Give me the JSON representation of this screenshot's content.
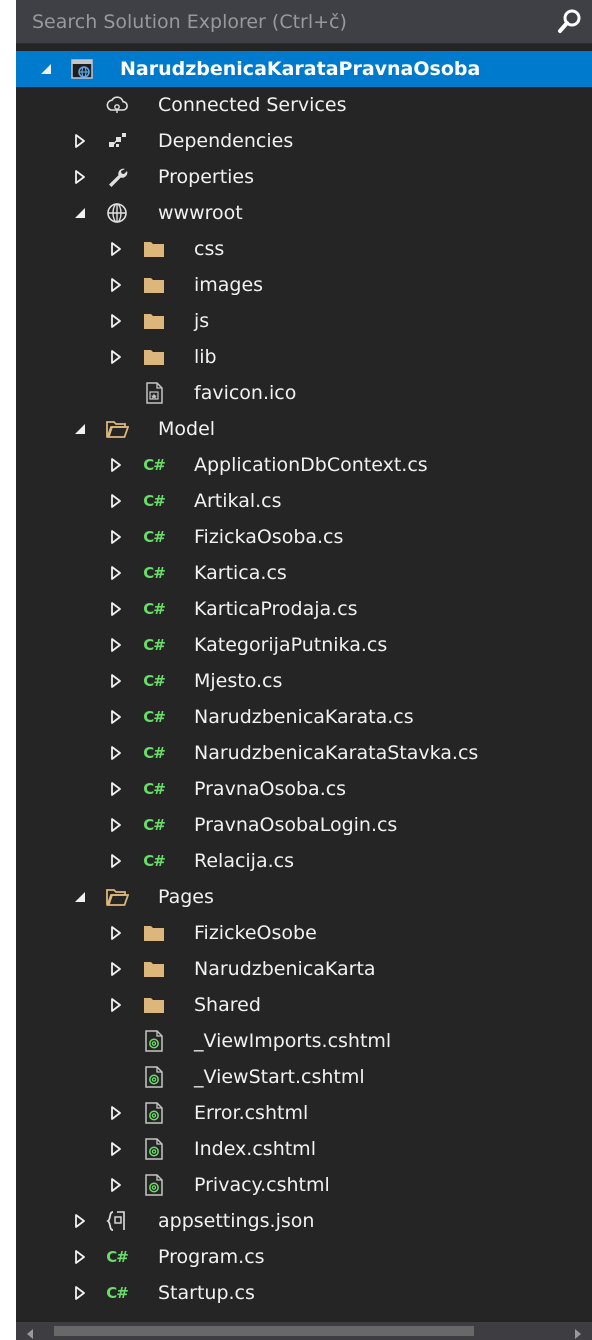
{
  "search": {
    "placeholder": "Search Solution Explorer (Ctrl+č)"
  },
  "colors": {
    "panel_background": "#252526",
    "search_background": "#3f3f46",
    "selected_row": "#007acc",
    "text": "#f1f1f1",
    "folder": "#dcb67a",
    "csharp": "#68dd68"
  },
  "tree": [
    {
      "label": "NarudzbenicaKarataPravnaOsoba",
      "level": 0,
      "toggle": "expanded",
      "icon": "web-project-icon",
      "selected": true
    },
    {
      "label": "Connected Services",
      "level": 1,
      "toggle": "none",
      "icon": "connected-services-icon"
    },
    {
      "label": "Dependencies",
      "level": 1,
      "toggle": "collapsed",
      "icon": "dependencies-icon"
    },
    {
      "label": "Properties",
      "level": 1,
      "toggle": "collapsed",
      "icon": "wrench-icon"
    },
    {
      "label": "wwwroot",
      "level": 1,
      "toggle": "expanded",
      "icon": "globe-icon"
    },
    {
      "label": "css",
      "level": 2,
      "toggle": "collapsed",
      "icon": "folder-icon"
    },
    {
      "label": "images",
      "level": 2,
      "toggle": "collapsed",
      "icon": "folder-icon"
    },
    {
      "label": "js",
      "level": 2,
      "toggle": "collapsed",
      "icon": "folder-icon"
    },
    {
      "label": "lib",
      "level": 2,
      "toggle": "collapsed",
      "icon": "folder-icon"
    },
    {
      "label": "favicon.ico",
      "level": 2,
      "toggle": "none",
      "icon": "ico-file-icon"
    },
    {
      "label": "Model",
      "level": 1,
      "toggle": "expanded",
      "icon": "folder-open-icon"
    },
    {
      "label": "ApplicationDbContext.cs",
      "level": 2,
      "toggle": "collapsed",
      "icon": "csharp-file-icon"
    },
    {
      "label": "Artikal.cs",
      "level": 2,
      "toggle": "collapsed",
      "icon": "csharp-file-icon"
    },
    {
      "label": "FizickaOsoba.cs",
      "level": 2,
      "toggle": "collapsed",
      "icon": "csharp-file-icon"
    },
    {
      "label": "Kartica.cs",
      "level": 2,
      "toggle": "collapsed",
      "icon": "csharp-file-icon"
    },
    {
      "label": "KarticaProdaja.cs",
      "level": 2,
      "toggle": "collapsed",
      "icon": "csharp-file-icon"
    },
    {
      "label": "KategorijaPutnika.cs",
      "level": 2,
      "toggle": "collapsed",
      "icon": "csharp-file-icon"
    },
    {
      "label": "Mjesto.cs",
      "level": 2,
      "toggle": "collapsed",
      "icon": "csharp-file-icon"
    },
    {
      "label": "NarudzbenicaKarata.cs",
      "level": 2,
      "toggle": "collapsed",
      "icon": "csharp-file-icon"
    },
    {
      "label": "NarudzbenicaKarataStavka.cs",
      "level": 2,
      "toggle": "collapsed",
      "icon": "csharp-file-icon"
    },
    {
      "label": "PravnaOsoba.cs",
      "level": 2,
      "toggle": "collapsed",
      "icon": "csharp-file-icon"
    },
    {
      "label": "PravnaOsobaLogin.cs",
      "level": 2,
      "toggle": "collapsed",
      "icon": "csharp-file-icon"
    },
    {
      "label": "Relacija.cs",
      "level": 2,
      "toggle": "collapsed",
      "icon": "csharp-file-icon"
    },
    {
      "label": "Pages",
      "level": 1,
      "toggle": "expanded",
      "icon": "folder-open-icon"
    },
    {
      "label": "FizickeOsobe",
      "level": 2,
      "toggle": "collapsed",
      "icon": "folder-icon"
    },
    {
      "label": "NarudzbenicaKarta",
      "level": 2,
      "toggle": "collapsed",
      "icon": "folder-icon"
    },
    {
      "label": "Shared",
      "level": 2,
      "toggle": "collapsed",
      "icon": "folder-icon"
    },
    {
      "label": "_ViewImports.cshtml",
      "level": 2,
      "toggle": "none",
      "icon": "razor-file-icon"
    },
    {
      "label": "_ViewStart.cshtml",
      "level": 2,
      "toggle": "none",
      "icon": "razor-file-icon"
    },
    {
      "label": "Error.cshtml",
      "level": 2,
      "toggle": "collapsed",
      "icon": "razor-file-icon"
    },
    {
      "label": "Index.cshtml",
      "level": 2,
      "toggle": "collapsed",
      "icon": "razor-file-icon"
    },
    {
      "label": "Privacy.cshtml",
      "level": 2,
      "toggle": "collapsed",
      "icon": "razor-file-icon"
    },
    {
      "label": "appsettings.json",
      "level": 1,
      "toggle": "collapsed",
      "icon": "json-file-icon"
    },
    {
      "label": "Program.cs",
      "level": 1,
      "toggle": "collapsed",
      "icon": "csharp-file-icon"
    },
    {
      "label": "Startup.cs",
      "level": 1,
      "toggle": "collapsed",
      "icon": "csharp-file-icon"
    }
  ]
}
